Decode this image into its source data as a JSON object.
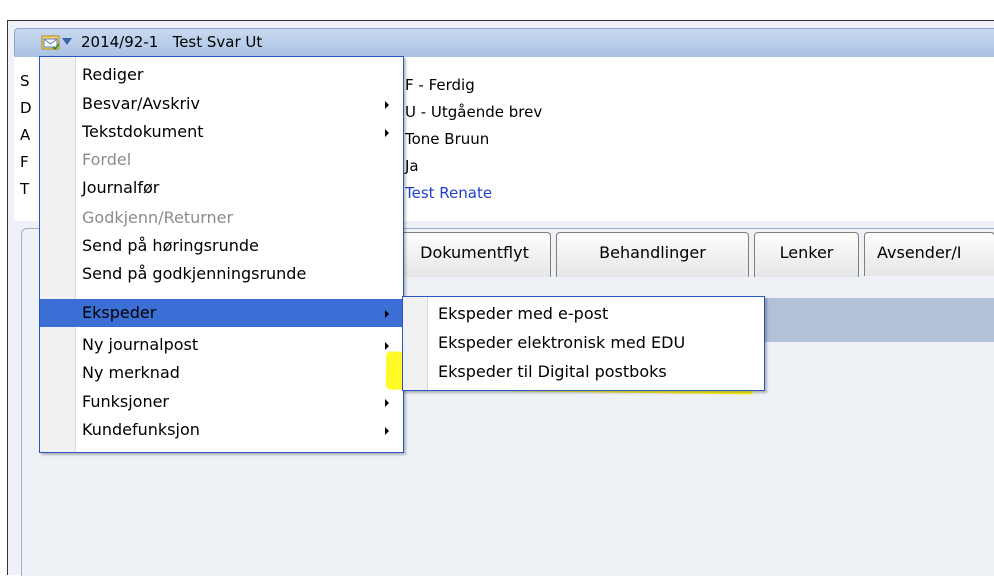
{
  "window": {
    "title_record": "2014/92-1",
    "title_name": "Test Svar Ut"
  },
  "info": {
    "keys": [
      "S",
      "D",
      "A",
      "F",
      "T"
    ],
    "values": [
      "F - Ferdig",
      "U - Utgående brev",
      "Tone Bruun",
      "Ja",
      "Test Renate"
    ]
  },
  "tabs": [
    "Dokumentflyt",
    "Behandlinger",
    "Lenker",
    "Avsender/I"
  ],
  "context_menu": {
    "items": [
      {
        "label": "Rediger",
        "submenu": false,
        "disabled": false
      },
      {
        "label": "Besvar/Avskriv",
        "submenu": true,
        "disabled": false
      },
      {
        "label": "Tekstdokument",
        "submenu": true,
        "disabled": false
      },
      {
        "label": "Fordel",
        "submenu": false,
        "disabled": true
      },
      {
        "label": "Journalfør",
        "submenu": false,
        "disabled": false
      },
      {
        "label": "Godkjenn/Returner",
        "submenu": false,
        "disabled": true
      },
      {
        "label": "Send på høringsrunde",
        "submenu": false,
        "disabled": false
      },
      {
        "label": "Send på godkjenningsrunde",
        "submenu": false,
        "disabled": false
      },
      {
        "label": "Ekspeder",
        "submenu": true,
        "disabled": false,
        "highlighted": true
      },
      {
        "label": "Ny journalpost",
        "submenu": true,
        "disabled": false
      },
      {
        "label": "Ny merknad",
        "submenu": false,
        "disabled": false
      },
      {
        "label": "Funksjoner",
        "submenu": true,
        "disabled": false
      },
      {
        "label": "Kundefunksjon",
        "submenu": true,
        "disabled": false
      }
    ]
  },
  "ekspeder_submenu": {
    "items": [
      {
        "label": "Ekspeder med e-post"
      },
      {
        "label": "Ekspeder elektronisk med EDU"
      },
      {
        "label": "Ekspeder til Digital postboks",
        "marked": true
      }
    ]
  },
  "colors": {
    "menu_highlight": "#3c6fd6",
    "marker_yellow": "#fff800",
    "link_blue": "#1f3fd0"
  },
  "icons": {
    "title_icon": "mail-folder-icon",
    "dropdown": "chevron-down-icon",
    "submenu_arrow": "chevron-right-icon"
  }
}
